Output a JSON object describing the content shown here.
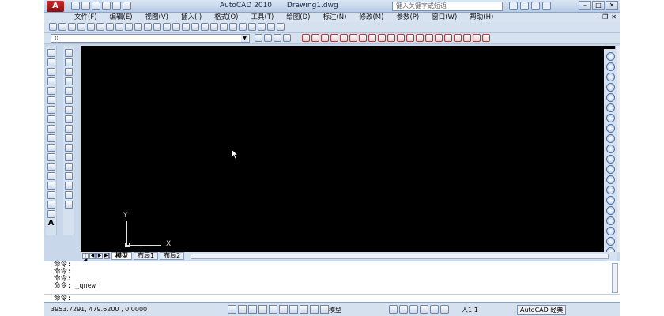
{
  "titlebar": {
    "logo": "A",
    "app_name": "AutoCAD 2010",
    "doc_name": "Drawing1.dwg",
    "search_placeholder": "键入关键字或短语"
  },
  "menu": {
    "items": [
      "文件(F)",
      "编辑(E)",
      "视图(V)",
      "插入(I)",
      "格式(O)",
      "工具(T)",
      "绘图(D)",
      "标注(N)",
      "修改(M)",
      "参数(P)",
      "窗口(W)",
      "帮助(H)"
    ]
  },
  "layer": {
    "current": "0"
  },
  "ucs": {
    "y_label": "Y",
    "x_label": "X"
  },
  "tabs": {
    "model": "模型",
    "layout1": "布局1",
    "layout2": "布局2"
  },
  "command": {
    "history": [
      "命令:",
      "命令:",
      "命令:",
      "命令: _qnew"
    ],
    "prompt": "命令:"
  },
  "status": {
    "coordinates": "3953.7291, 479.6200 , 0.0000",
    "model": "模型",
    "scale": "人1:1",
    "workspace": "AutoCAD 经典"
  },
  "colors": {
    "canvas": "#000000",
    "chrome": "#c9d7ea"
  }
}
